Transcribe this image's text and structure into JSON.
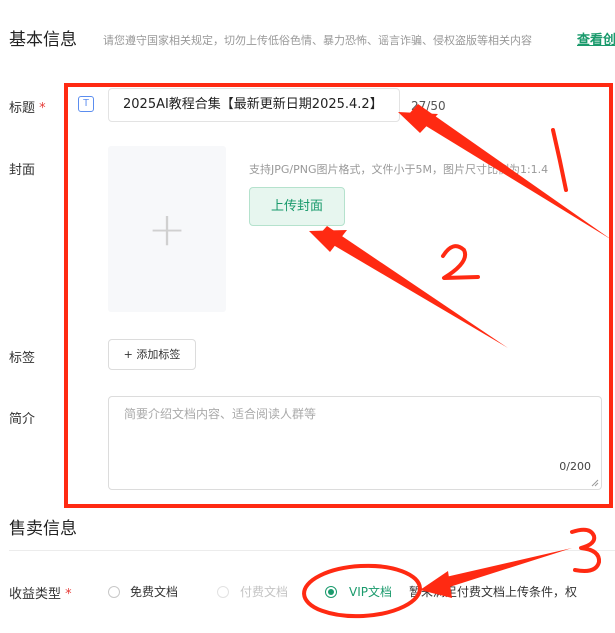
{
  "basic_info": {
    "heading": "基本信息",
    "notice": "请您遵守国家相关规定，切勿上传低俗色情、暴力恐怖、谣言诈骗、侵权盗版等相关内容",
    "notice_link": "查看创"
  },
  "title_field": {
    "label": "标题",
    "required_mark": "*",
    "type_icon": "T",
    "value": "2025AI教程合集【最新更新日期2025.4.2】",
    "counter": "27/50"
  },
  "cover_field": {
    "label": "封面",
    "placeholder_icon": "+",
    "hint": "支持JPG/PNG图片格式，文件小于5M，图片尺寸比例为1:1.4",
    "upload_button": "上传封面"
  },
  "tags_field": {
    "label": "标签",
    "add_button": "+ 添加标签"
  },
  "intro_field": {
    "label": "简介",
    "placeholder": "简要介绍文档内容、适合阅读人群等",
    "counter": "0/200"
  },
  "sale_info": {
    "heading": "售卖信息",
    "revenue_label": "收益类型",
    "required_mark": "*",
    "options": [
      {
        "label": "免费文档",
        "state": "unselected"
      },
      {
        "label": "付费文档",
        "state": "disabled"
      },
      {
        "label": "VIP文档",
        "state": "selected"
      }
    ],
    "trailing_note": "暂未满足付费文档上传条件，权"
  },
  "annotations": {
    "marker_1": "1",
    "marker_2": "2",
    "marker_3": "3",
    "color": "#ff2a12"
  }
}
